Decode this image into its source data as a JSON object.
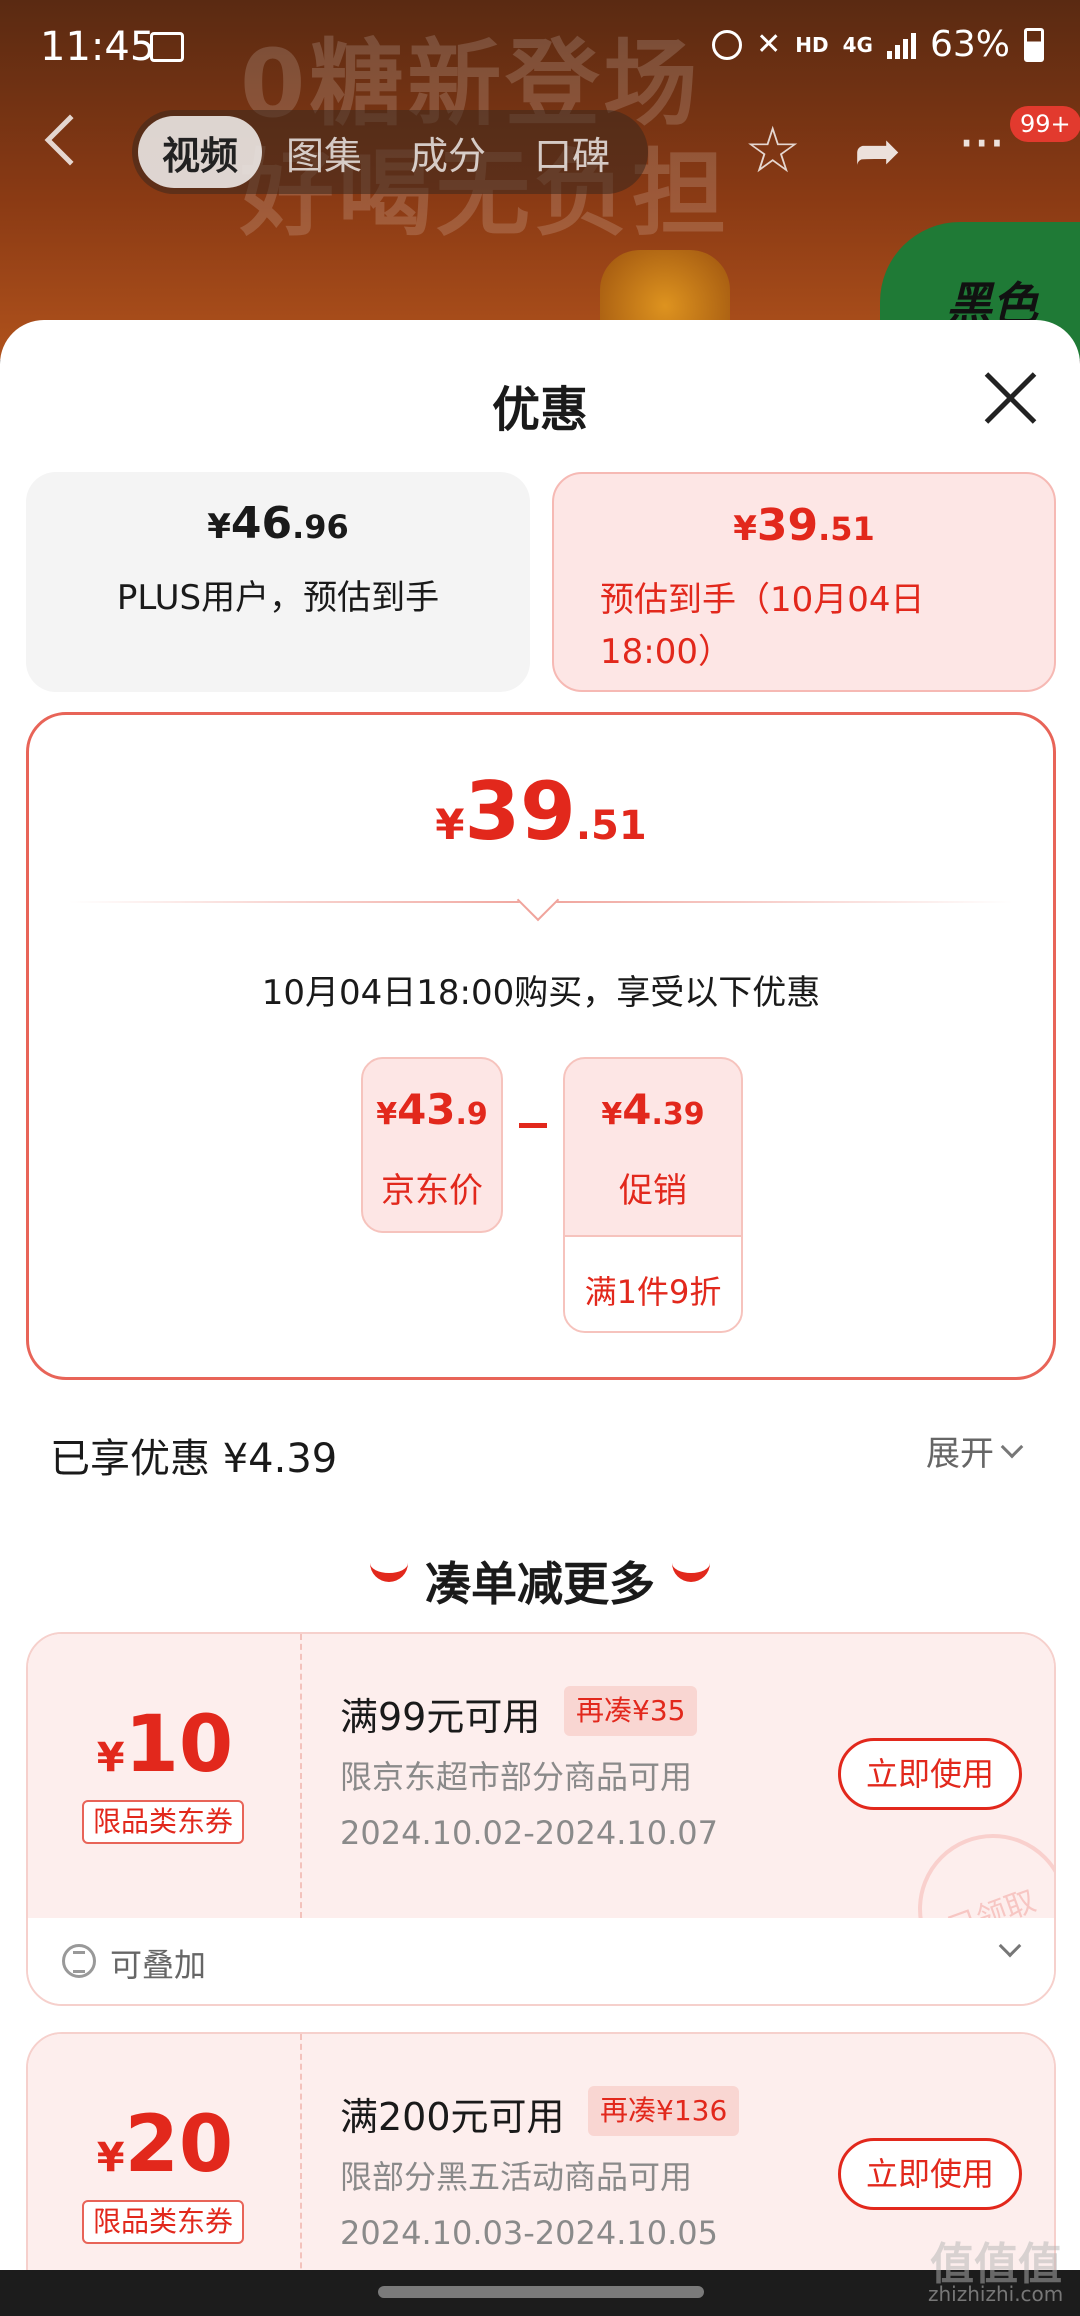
{
  "status": {
    "time": "11:45",
    "hd": "HD",
    "net": "4G",
    "battery": "63%"
  },
  "background": {
    "promo_text": "0糖新登场\n好喝无负担",
    "green_label": "黑色"
  },
  "nav": {
    "tabs": [
      {
        "label": "视频",
        "active": true
      },
      {
        "label": "图集"
      },
      {
        "label": "成分"
      },
      {
        "label": "口碑"
      }
    ],
    "badge": "99+"
  },
  "sheet": {
    "title": "优惠",
    "plus_card": {
      "yen": "¥",
      "int": "46",
      "dec": ".96",
      "label": "PLUS用户，预估到手"
    },
    "est_card": {
      "yen": "¥",
      "int": "39",
      "dec": ".51",
      "label": "预估到手（10月04日18:00）"
    },
    "detail": {
      "yen": "¥",
      "int": "39",
      "dec": ".51",
      "subtitle": "10月04日18:00购买，享受以下优惠",
      "jd_price": {
        "yen": "¥",
        "int": "43",
        "dec": ".9",
        "label": "京东价"
      },
      "promo": {
        "yen": "¥",
        "int": "4",
        "dec": ".39",
        "label": "促销",
        "rule": "满1件9折"
      }
    },
    "saved": "已享优惠 ¥4.39",
    "expand": "展开",
    "section_title": "凑单减更多",
    "coupons": [
      {
        "yen": "¥",
        "amount": "10",
        "type": "限品类东券",
        "condition": "满99元可用",
        "tag": "再凑¥35",
        "desc": "限京东超市部分商品可用",
        "date": "2024.10.02-2024.10.07",
        "button": "立即使用",
        "stamp": "已领取",
        "stack_label": "可叠加"
      },
      {
        "yen": "¥",
        "amount": "20",
        "type": "限品类东券",
        "condition": "满200元可用",
        "tag": "再凑¥136",
        "desc": "限部分黑五活动商品可用",
        "date": "2024.10.03-2024.10.05",
        "button": "立即使用"
      }
    ]
  },
  "watermark": {
    "text": "值值值",
    "site": "zhizhizhi.com"
  },
  "colors": {
    "accent": "#e2281c",
    "accent_bg": "#fde6e5"
  }
}
